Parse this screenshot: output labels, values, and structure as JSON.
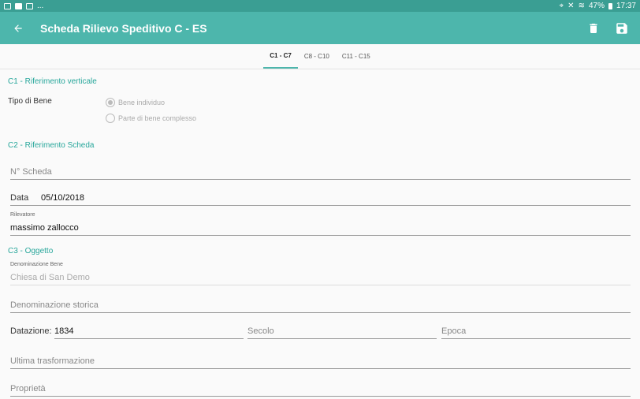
{
  "statusbar": {
    "left_text": "...",
    "battery": "47%",
    "time": "17:37"
  },
  "appbar": {
    "title": "Scheda Rilievo Speditivo C - ES"
  },
  "tabs": [
    {
      "label": "C1 - C7",
      "active": true
    },
    {
      "label": "C8 - C10",
      "active": false
    },
    {
      "label": "C11 - C15",
      "active": false
    }
  ],
  "c1": {
    "title": "C1 - Riferimento verticale",
    "tipo_label": "Tipo di Bene",
    "options": [
      "Bene individuo",
      "Parte di bene complesso"
    ]
  },
  "c2": {
    "title": "C2 - Riferimento Scheda",
    "n_scheda_placeholder": "N° Scheda",
    "data_label": "Data",
    "data_value": "05/10/2018",
    "rilevatore_label": "Rilevatore",
    "rilevatore_value": "massimo zallocco"
  },
  "c3": {
    "title": "C3 - Oggetto",
    "denominazione_label": "Denominazione Bene",
    "denominazione_value": "Chiesa di San Demo",
    "denominazione_storica_placeholder": "Denominazione storica",
    "datazione_label": "Datazione:",
    "datazione_value": "1834",
    "secolo_placeholder": "Secolo",
    "epoca_placeholder": "Epoca",
    "ultima_trasformazione_placeholder": "Ultima trasformazione",
    "proprieta_placeholder": "Proprietà"
  },
  "colors": {
    "appbar": "#4db6ac",
    "statusbar": "#3a9e93",
    "accent": "#26a69a"
  }
}
